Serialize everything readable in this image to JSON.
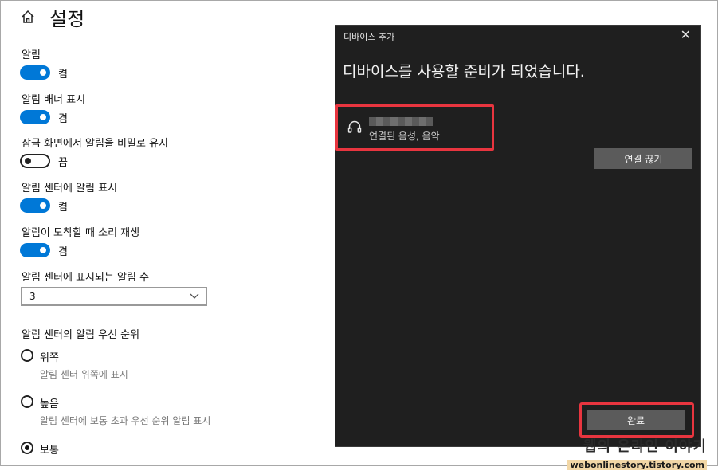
{
  "settings": {
    "title": "설정",
    "toggles": [
      {
        "label": "알림",
        "state": "켬",
        "on": true
      },
      {
        "label": "알림 배너 표시",
        "state": "켬",
        "on": true
      },
      {
        "label": "잠금 화면에서 알림을 비밀로 유지",
        "state": "끔",
        "on": false
      },
      {
        "label": "알림 센터에 알림 표시",
        "state": "켬",
        "on": true
      },
      {
        "label": "알림이 도착할 때 소리 재생",
        "state": "켬",
        "on": true
      }
    ],
    "count_label": "알림 센터에 표시되는 알림 수",
    "count_value": "3",
    "priority_label": "알림 센터의 알림 우선 순위",
    "priority_options": [
      {
        "label": "위쪽",
        "desc": "알림 센터 위쪽에 표시",
        "checked": false
      },
      {
        "label": "높음",
        "desc": "알림 센터에 보통 초과 우선 순위 알림 표시",
        "checked": false
      },
      {
        "label": "보통",
        "checked": true
      }
    ]
  },
  "dialog": {
    "title": "디바이스 추가",
    "heading": "디바이스를 사용할 준비가 되었습니다.",
    "device": {
      "status": "연결된 음성, 음악",
      "icon": "headphone-icon"
    },
    "disconnect_label": "연결 끊기",
    "done_label": "완료"
  },
  "watermark": {
    "title": "웹의 온라인 이야기",
    "url": "webonlinestory.tistory.com"
  },
  "colors": {
    "accent": "#0078d7",
    "dialog_bg": "#1f1f1f",
    "highlight": "#e8353f"
  }
}
